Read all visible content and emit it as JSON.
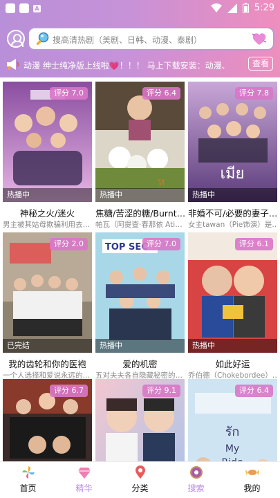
{
  "status_bar": {
    "time": "5:29"
  },
  "search": {
    "placeholder": "搜高清热剧（美剧、日韩、动漫、泰剧）"
  },
  "notice": {
    "text": "动漫  绅士纯净版上线啦💗！！！   马上下载安装：动漫、",
    "button": "查看"
  },
  "colors": {
    "header_start": "#b88fd8",
    "header_end": "#ee8fbe",
    "accent": "#b98ce0",
    "rating_bg": "#d977c8"
  },
  "cards": [
    {
      "rating": "评分 7.0",
      "status": "热播中",
      "title": "神秘之火/迷火",
      "subtitle": "男主被其姑母欺骗利用去…",
      "art": "purple"
    },
    {
      "rating": "评分 6.4",
      "status": "热播中",
      "title": "焦糖/苦涩的糖/Burnt…",
      "subtitle": "帕瓦（阿提查·春那依 Ati…",
      "art": "green"
    },
    {
      "rating": "评分 7.8",
      "status": "热播中",
      "title": "非婚不可/必要的妻子…",
      "subtitle": "女主tawan（Pie饰演）是…",
      "art": "violet"
    },
    {
      "rating": "评分 2.0",
      "status": "已完结",
      "title": "我的齿轮和你的医袍",
      "subtitle": "一个人选择和爱说永远的…",
      "art": "gray"
    },
    {
      "rating": "评分 7.0",
      "status": "热播中",
      "title": "爱的机密",
      "subtitle": "五对夫夫各自隐藏秘密的…",
      "art": "blue"
    },
    {
      "rating": "评分 6.1",
      "status": "热播中",
      "title": "如此好运",
      "subtitle": "乔伯德（Chokebordee）…",
      "art": "red"
    },
    {
      "rating": "评分 6.7",
      "status": "",
      "title": "",
      "subtitle": "",
      "art": "dark"
    },
    {
      "rating": "评分 9.1",
      "status": "",
      "title": "",
      "subtitle": "",
      "art": "pink"
    },
    {
      "rating": "评分 6.4",
      "status": "",
      "title": "",
      "subtitle": "",
      "art": "sky"
    }
  ],
  "nav": [
    {
      "label": "首页",
      "icon": "pinwheel-icon",
      "active": false
    },
    {
      "label": "精华",
      "icon": "diamond-icon",
      "active": true
    },
    {
      "label": "分类",
      "icon": "location-pin-icon",
      "active": false
    },
    {
      "label": "搜索",
      "icon": "donut-icon",
      "active": true
    },
    {
      "label": "我的",
      "icon": "candy-icon",
      "active": false
    }
  ]
}
